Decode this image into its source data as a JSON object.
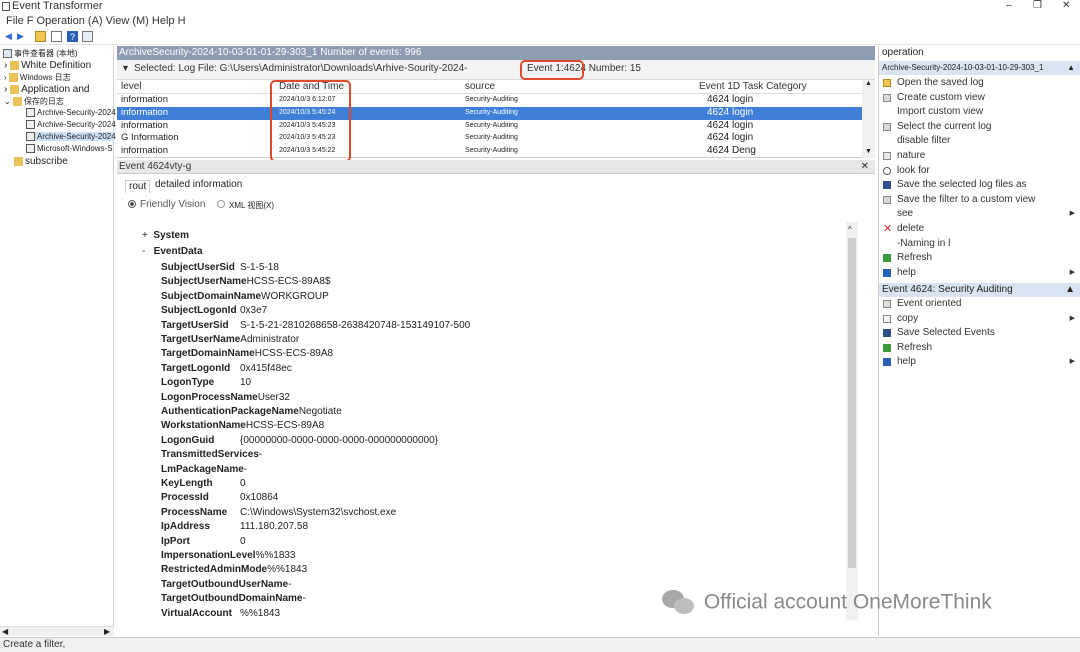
{
  "window": {
    "title": "Event Transformer",
    "min_icon": "minimize-icon",
    "max_icon": "restore-icon",
    "close_icon": "close-icon"
  },
  "menu": {
    "text": "File F Operation (A) View (M) Help H"
  },
  "tree": {
    "root": "事件查看器 (本地)",
    "items": [
      "White Definition",
      "Windows 日志",
      "Application and",
      "保存的日志",
      "Archive-Security-2024",
      "Archive-Security-2024",
      "Archive-Security-2024",
      "Microsoft-Windows-S",
      "subscribe"
    ]
  },
  "status": "Create a filter,",
  "log": {
    "header": "ArchiveSecurity-2024-10-03-01-01-29-303_1 Number of events: 996",
    "subhead_path": "Selected: Log File: G:\\Users\\Administrator\\Downloads\\Arhive-Sourity-2024-",
    "subhead_event": "Event 1:4624 Number: 15",
    "columns": {
      "level": "level",
      "date": "Date and Time",
      "source": "source",
      "event": "Event 1D Task Category"
    },
    "rows": [
      {
        "level": "information",
        "date": "2024/10/3 6:12:07",
        "source": "Security-Auditing",
        "event": "4624 login"
      },
      {
        "level": "information",
        "date": "2024/10/3 5:45:24",
        "source": "Security-Auditing",
        "event": "4624 login"
      },
      {
        "level": "information",
        "date": "2024/10/3 5:45:23",
        "source": "Security-Auditing",
        "event": "4624 login"
      },
      {
        "level": "G Information",
        "date": "2024/10/3 5:45:23",
        "source": "Security-Auditing",
        "event": "4624 login"
      },
      {
        "level": "information",
        "date": "2024/10/3 5:45:22",
        "source": "Security-Auditing",
        "event": "4624 Deng"
      }
    ]
  },
  "detail_pane": {
    "title": "Event 4624vty-g",
    "tab_general": "rout",
    "tab_detail": "detailed information",
    "radio_friendly": "Friendly Vision",
    "radio_xml": "XML 视图(X)",
    "system_label": "System",
    "eventdata_label": "EventData",
    "fields": [
      {
        "k": "SubjectUserSid",
        "v": "S-1-5-18"
      },
      {
        "k": "SubjectUserName",
        "v": "HCSS-ECS-89A8$"
      },
      {
        "k": "SubjectDomainName",
        "v": "WORKGROUP"
      },
      {
        "k": "SubjectLogonId",
        "v": "0x3e7"
      },
      {
        "k": "TargetUserSid",
        "v": "S-1-5-21-2810268658-2638420748-153149107-500"
      },
      {
        "k": "TargetUserName",
        "v": "Administrator"
      },
      {
        "k": "TargetDomainName",
        "v": "HCSS-ECS-89A8"
      },
      {
        "k": "TargetLogonId",
        "v": "0x415f48ec"
      },
      {
        "k": "LogonType",
        "v": "10"
      },
      {
        "k": "LogonProcessName",
        "v": "User32"
      },
      {
        "k": "AuthenticationPackageName",
        "v": "Negotiate"
      },
      {
        "k": "WorkstationName",
        "v": "HCSS-ECS-89A8"
      },
      {
        "k": "LogonGuid",
        "v": "{00000000-0000-0000-0000-000000000000}"
      },
      {
        "k": "TransmittedServices",
        "v": "-"
      },
      {
        "k": "LmPackageName",
        "v": "-"
      },
      {
        "k": "KeyLength",
        "v": "0"
      },
      {
        "k": "ProcessId",
        "v": "0x10864"
      },
      {
        "k": "ProcessName",
        "v": "C:\\Windows\\System32\\svchost.exe"
      },
      {
        "k": "IpAddress",
        "v": "111.180.207.58"
      },
      {
        "k": "IpPort",
        "v": "0"
      },
      {
        "k": "ImpersonationLevel",
        "v": "%%1833"
      },
      {
        "k": "RestrictedAdminMode",
        "v": "%%1843"
      },
      {
        "k": "TargetOutboundUserName",
        "v": "-"
      },
      {
        "k": "TargetOutboundDomainName",
        "v": "-"
      },
      {
        "k": "VirtualAccount",
        "v": "%%1843"
      }
    ]
  },
  "actions": {
    "header": "operation",
    "log_title": "Archive-Security-2024-10-03-01-10-29-303_1",
    "items": [
      {
        "label": "Open the saved log",
        "icon": "folder-icon"
      },
      {
        "label": "Create custom view",
        "icon": "filter-icon"
      },
      {
        "label": "Import custom view",
        "icon": ""
      },
      {
        "label": "Select the current log",
        "icon": "filter-icon"
      },
      {
        "label": "disable filter",
        "icon": ""
      },
      {
        "label": "nature",
        "icon": "properties-icon"
      },
      {
        "label": "look for",
        "icon": "find-icon"
      },
      {
        "label": "Save the selected log files as",
        "icon": "save-icon"
      },
      {
        "label": "Save the filter to a custom view",
        "icon": "filter-icon"
      },
      {
        "label": "see",
        "icon": "",
        "arrow": true
      },
      {
        "label": "delete",
        "icon": "delete-icon"
      },
      {
        "label": "-Naming in l",
        "icon": ""
      },
      {
        "label": "Refresh",
        "icon": "refresh-icon"
      },
      {
        "label": "help",
        "icon": "help-icon",
        "arrow": true
      }
    ],
    "event_header": "Event 4624: Security Auditing",
    "event_items": [
      {
        "label": "Event oriented",
        "icon": "task-icon"
      },
      {
        "label": "copy",
        "icon": "copy-icon",
        "arrow": true
      },
      {
        "label": "Save Selected Events",
        "icon": "save-icon"
      },
      {
        "label": "Refresh",
        "icon": "refresh-icon"
      },
      {
        "label": "help",
        "icon": "help-icon",
        "arrow": true
      }
    ]
  },
  "watermark": "Official account OneMoreThink",
  "colors": {
    "selection": "#3f7fd8",
    "highlight_box": "#e04a2c",
    "header_bar": "#8e9cb1",
    "action_header": "#d9e4f2"
  }
}
